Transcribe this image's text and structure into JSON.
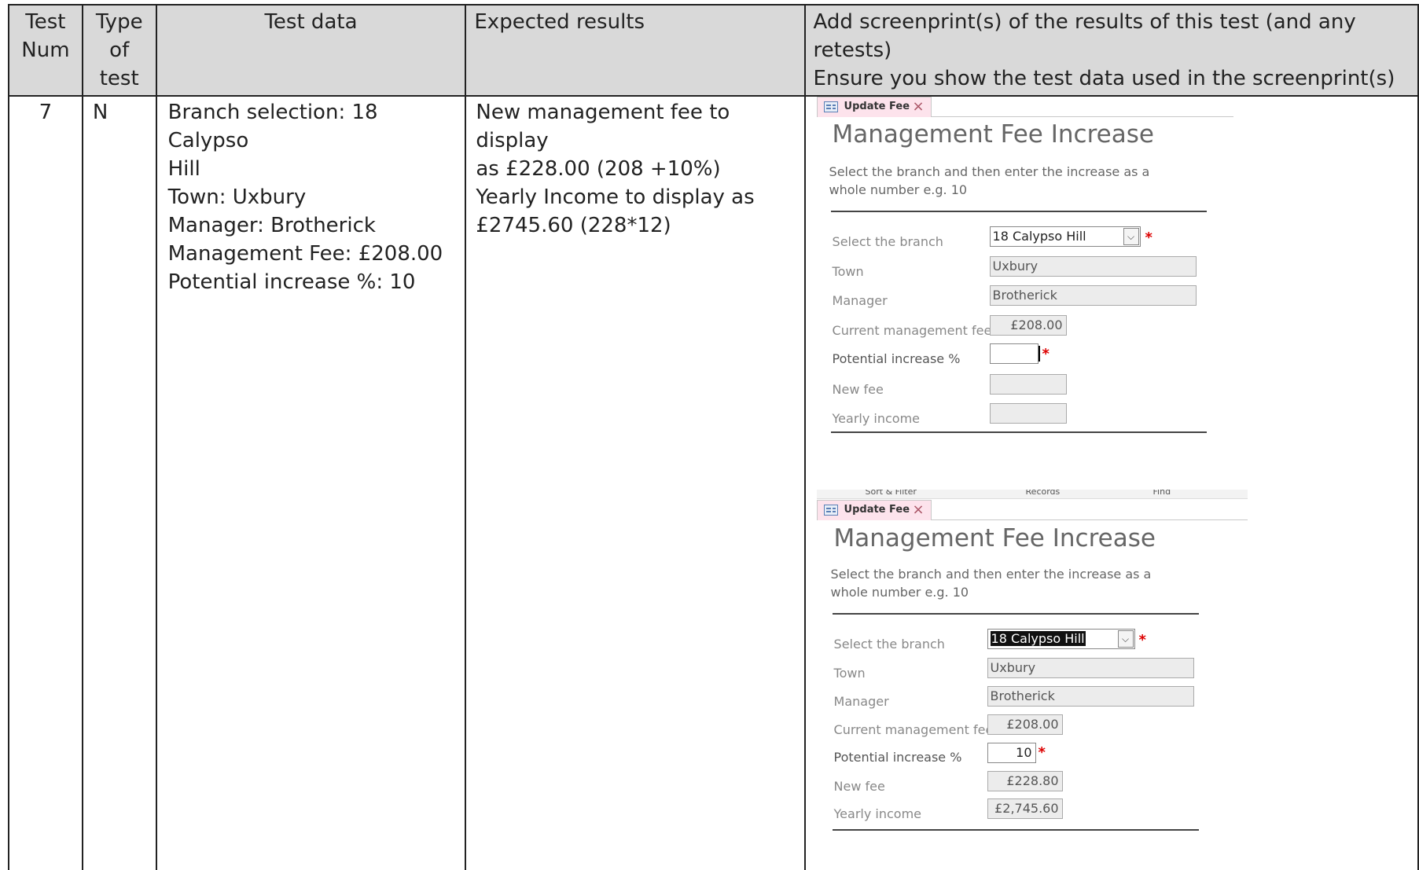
{
  "table": {
    "headers": {
      "test_num": [
        "Test",
        "Num"
      ],
      "type_of_test": [
        "Type",
        "of",
        "test"
      ],
      "test_data": "Test data",
      "expected_results": "Expected results",
      "screenprint": [
        "Add screenprint(s) of the results of this test (and any retests)",
        "Ensure you show the test data used in the screenprint(s)"
      ]
    },
    "row": {
      "test_num": "7",
      "type": "N",
      "test_data": [
        "Branch selection: 18 Calypso",
        "Hill",
        "Town: Uxbury",
        "Manager: Brotherick",
        "Management Fee: £208.00",
        "Potential increase %: 10"
      ],
      "expected_results": [
        "New management fee to display",
        "as £228.00 (208 +10%)",
        "Yearly Income to display as",
        "£2745.60 (228*12)"
      ]
    }
  },
  "screenshot_before": {
    "tab_label": "Update Fee",
    "form_title": "Management Fee Increase",
    "instructions": "Select the branch and then enter the increase as a whole number e.g. 10",
    "labels": {
      "branch": "Select the branch",
      "town": "Town",
      "manager": "Manager",
      "current_fee": "Current management fee",
      "increase": "Potential increase %",
      "new_fee": "New fee",
      "yearly_income": "Yearly income"
    },
    "values": {
      "branch": "18 Calypso Hill",
      "town": "Uxbury",
      "manager": "Brotherick",
      "current_fee": "£208.00",
      "increase": "",
      "new_fee": "",
      "yearly_income": ""
    },
    "required_mark": "*"
  },
  "screenshot_after": {
    "ribbon": [
      "Sort & Filter",
      "Records",
      "Find"
    ],
    "tab_label": "Update Fee",
    "form_title": "Management Fee Increase",
    "instructions": "Select the branch and then enter the increase as a whole number e.g. 10",
    "labels": {
      "branch": "Select the branch",
      "town": "Town",
      "manager": "Manager",
      "current_fee": "Current management fee",
      "increase": "Potential increase %",
      "new_fee": "New fee",
      "yearly_income": "Yearly income"
    },
    "values": {
      "branch": "18 Calypso Hill",
      "town": "Uxbury",
      "manager": "Brotherick",
      "current_fee": "£208.00",
      "increase": "10",
      "new_fee": "£228.80",
      "yearly_income": "£2,745.60"
    },
    "required_mark": "*"
  }
}
